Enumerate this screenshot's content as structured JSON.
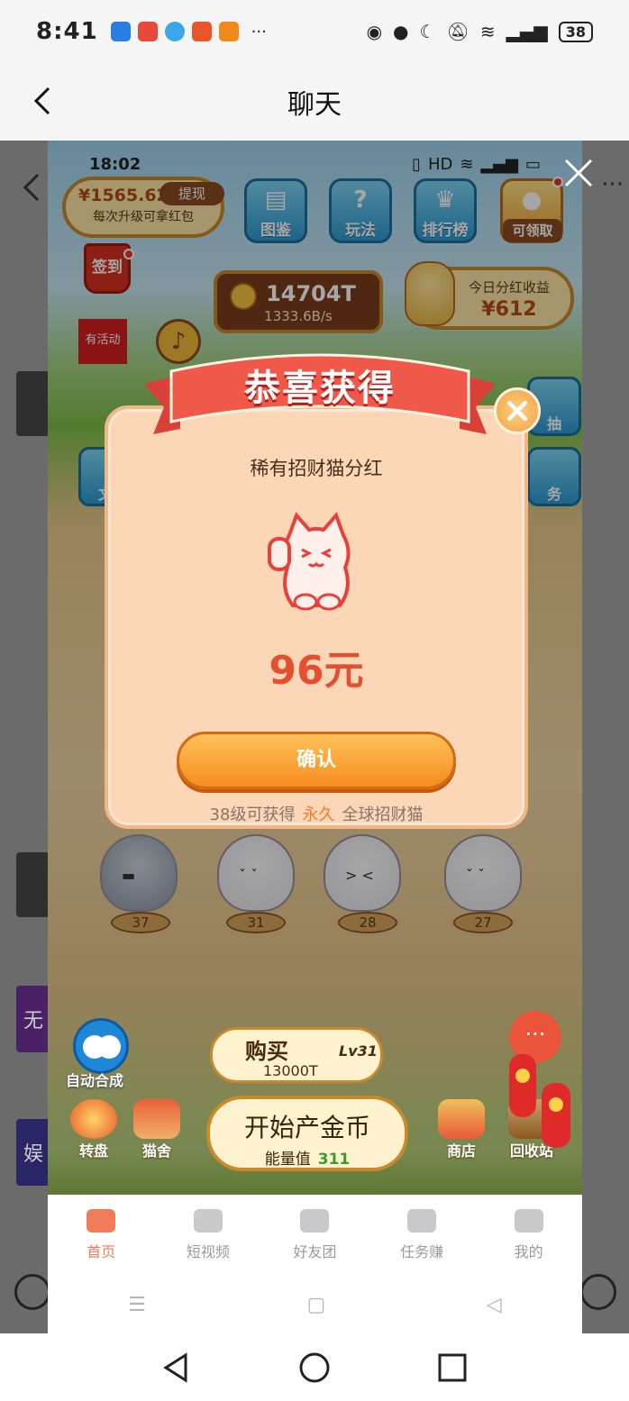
{
  "status": {
    "time": "8:41",
    "battery": "38",
    "more": "···"
  },
  "nav": {
    "title": "聊天"
  },
  "dim_chat": {
    "tag_1": "无",
    "tag_2": "娱",
    "side_dots": "···"
  },
  "game": {
    "inner_time": "18:02",
    "balance": {
      "amount": "¥1565.62",
      "withdraw_label": "提现",
      "note": "每次升级可拿红包"
    },
    "top_buttons": [
      {
        "label": "图鉴",
        "icon": "book-icon"
      },
      {
        "label": "玩法",
        "icon": "question-book-icon"
      },
      {
        "label": "排行榜",
        "icon": "crown-icon"
      },
      {
        "label": "可领取",
        "icon": "paw-coin-icon"
      }
    ],
    "sign_label": "签到",
    "activity_label": "有活动",
    "coins": {
      "value": "14704T",
      "rate": "1333.6B/s"
    },
    "dividend": {
      "label": "今日分红收益",
      "value": "¥612"
    },
    "side_buttons": [
      {
        "label": "抽"
      },
      {
        "label": "务"
      },
      {
        "label": "文"
      }
    ],
    "cats": [
      {
        "level": "37"
      },
      {
        "level": "31"
      },
      {
        "level": "28"
      },
      {
        "level": "27"
      }
    ],
    "auto_merge_label": "自动合成",
    "buy": {
      "label": "购买",
      "price": "13000T",
      "level": "Lv31"
    },
    "produce": {
      "title": "开始产金币",
      "energy_label": "能量值",
      "energy_value": "311"
    },
    "bottom_buttons": [
      {
        "label": "转盘"
      },
      {
        "label": "猫舍"
      },
      {
        "label": "商店"
      },
      {
        "label": "回收站"
      }
    ]
  },
  "modal": {
    "title": "恭喜获得",
    "subtitle": "稀有招财猫分红",
    "amount": "96元",
    "confirm_label": "确认",
    "note_pre": "38级可获得",
    "note_highlight": "永久",
    "note_post": "全球招财猫"
  },
  "tabs": [
    {
      "label": "首页",
      "active": true
    },
    {
      "label": "短视频",
      "active": false
    },
    {
      "label": "好友团",
      "active": false
    },
    {
      "label": "任务赚",
      "active": false
    },
    {
      "label": "我的",
      "active": false
    }
  ],
  "colors": {
    "accent_orange": "#f58d1e",
    "amount_red": "#e4502f",
    "tab_active": "#f07c5a",
    "energy_green": "#3c9e2a"
  }
}
